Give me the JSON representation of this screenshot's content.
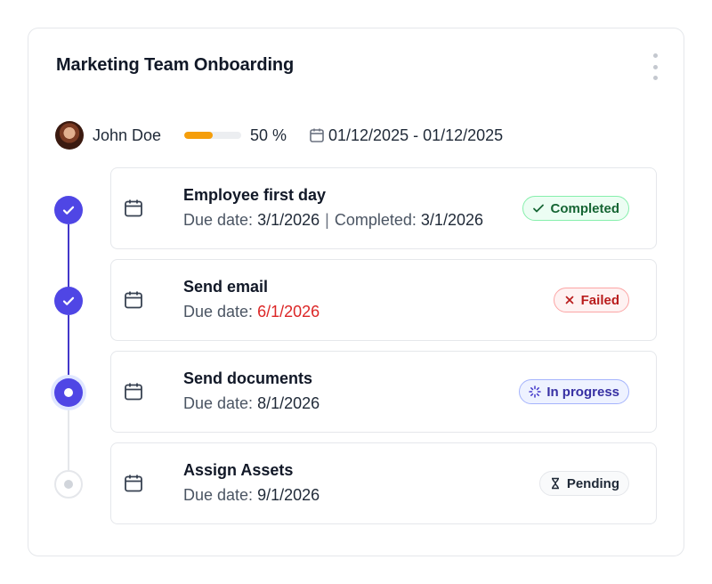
{
  "card": {
    "title": "Marketing Team Onboarding",
    "menu_icon": "kebab-menu-icon"
  },
  "meta": {
    "user_name": "John Doe",
    "progress_fraction": 0.5,
    "progress_text": "50 %",
    "date_icon": "calendar-icon",
    "date_range": "01/12/2025 - 01/12/2025"
  },
  "tasks": [
    {
      "title": "Employee first day",
      "due_label": "Due date:",
      "due_value": "3/1/2026",
      "separator": "|",
      "completed_label": "Completed:",
      "completed_value": "3/1/2026",
      "status": "Completed",
      "status_icon": "check-icon",
      "node_state": "done"
    },
    {
      "title": "Send email",
      "due_label": "Due date:",
      "due_value": "6/1/2026",
      "status": "Failed",
      "status_icon": "x-icon",
      "node_state": "done",
      "overdue_color": "#dc2626"
    },
    {
      "title": "Send documents",
      "due_label": "Due date:",
      "due_value": "8/1/2026",
      "status": "In progress",
      "status_icon": "spinner-icon",
      "node_state": "current"
    },
    {
      "title": "Assign Assets",
      "due_label": "Due date:",
      "due_value": "9/1/2026",
      "status": "Pending",
      "status_icon": "hourglass-icon",
      "node_state": "pending"
    }
  ],
  "colors": {
    "accent": "#4f46e5",
    "progress": "#f59e0b",
    "completed": "#166534",
    "failed": "#b91c1c",
    "in_progress": "#3730a3"
  }
}
